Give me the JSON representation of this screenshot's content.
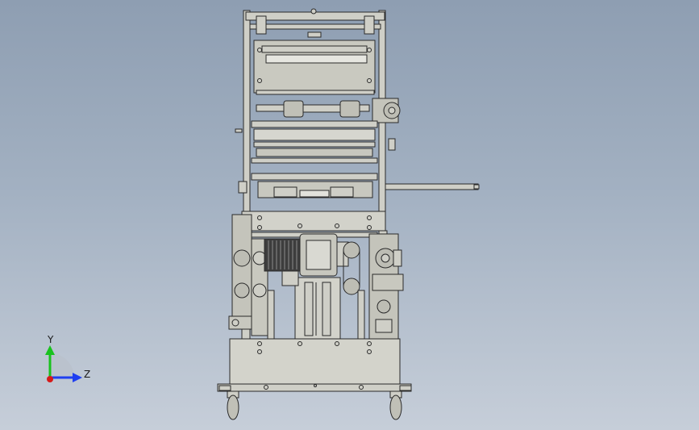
{
  "viewport": {
    "background_top": "#8e9eb2",
    "background_bottom": "#c6ced9",
    "part_fill": "#cfcfc7",
    "part_fill_dark": "#b8b8ae",
    "edge_color": "#2a2a2a"
  },
  "triad": {
    "y_label": "Y",
    "z_label": "Z",
    "y_color": "#19c21e",
    "z_color": "#1f3ff0",
    "x_color": "#d61a1a"
  }
}
